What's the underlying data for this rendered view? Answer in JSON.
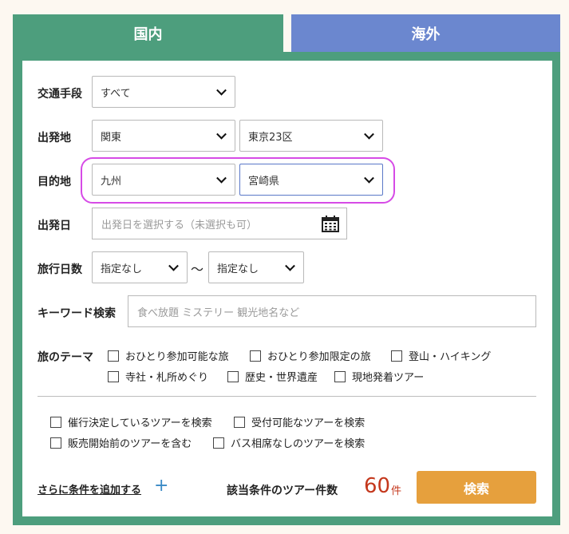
{
  "tabs": {
    "domestic": "国内",
    "overseas": "海外"
  },
  "form": {
    "transport": {
      "label": "交通手段",
      "value": "すべて"
    },
    "departure": {
      "label": "出発地",
      "region": "関東",
      "area": "東京23区"
    },
    "destination": {
      "label": "目的地",
      "region": "九州",
      "area": "宮崎県"
    },
    "departure_date": {
      "label": "出発日",
      "placeholder": "出発日を選択する（未選択も可）"
    },
    "trip_days": {
      "label": "旅行日数",
      "from": "指定なし",
      "separator": "〜",
      "to": "指定なし"
    },
    "keyword": {
      "label": "キーワード検索",
      "placeholder": "食べ放題 ミステリー 観光地名など"
    },
    "theme": {
      "label": "旅のテーマ",
      "options": [
        "おひとり参加可能な旅",
        "おひとり参加限定の旅",
        "登山・ハイキング",
        "寺社・札所めぐり",
        "歴史・世界遺産",
        "現地発着ツアー"
      ]
    },
    "filters": [
      "催行決定しているツアーを検索",
      "受付可能なツアーを検索",
      "販売開始前のツアーを含む",
      "バス相席なしのツアーを検索"
    ]
  },
  "footer": {
    "add_conditions": "さらに条件を追加する",
    "plus": "+",
    "count_label": "該当条件のツアー件数",
    "count": "60",
    "count_unit": "件",
    "search_button": "検索"
  },
  "colors": {
    "domestic_tab": "#4d9e7d",
    "overseas_tab": "#6b87cf",
    "search_button": "#e6a03d",
    "count": "#c4381d",
    "highlight": "#d64be6"
  }
}
